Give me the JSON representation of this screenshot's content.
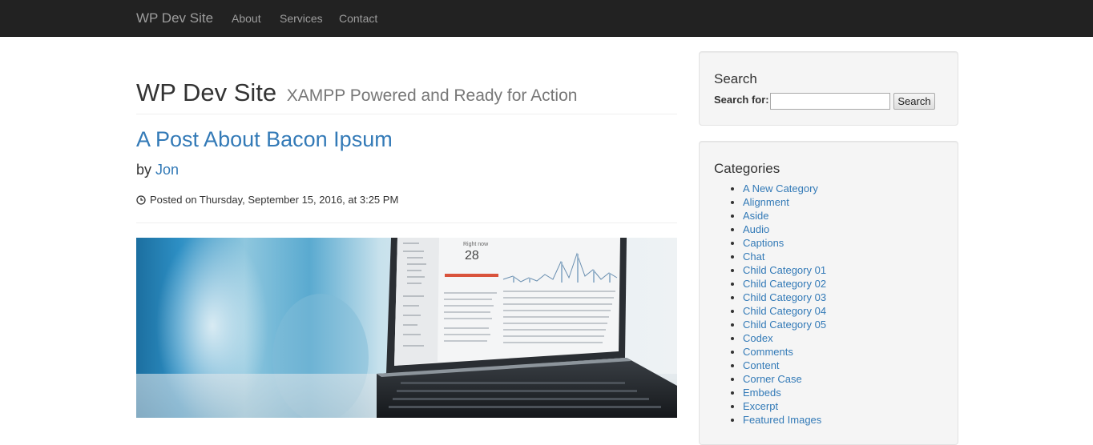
{
  "navbar": {
    "brand": "WP Dev Site",
    "links": [
      "About",
      "Services",
      "Contact"
    ]
  },
  "header": {
    "title": "WP Dev Site",
    "tagline": "XAMPP Powered and Ready for Action"
  },
  "post": {
    "title": "A Post About Bacon Ipsum",
    "by_label": "by",
    "author": "Jon",
    "posted_on": "Posted on Thursday, September 15, 2016, at 3:25 PM",
    "image_screen_number": "28",
    "image_screen_label": "Right now"
  },
  "search_widget": {
    "title": "Search",
    "label": "Search for:",
    "input_value": "",
    "button_label": "Search"
  },
  "categories_widget": {
    "title": "Categories",
    "items": [
      "A New Category",
      "Alignment",
      "Aside",
      "Audio",
      "Captions",
      "Chat",
      "Child Category 01",
      "Child Category 02",
      "Child Category 03",
      "Child Category 04",
      "Child Category 05",
      "Codex",
      "Comments",
      "Content",
      "Corner Case",
      "Embeds",
      "Excerpt",
      "Featured Images"
    ]
  },
  "colors": {
    "navbar_bg": "#222222",
    "link": "#337ab7",
    "widget_bg": "#f5f5f5"
  }
}
